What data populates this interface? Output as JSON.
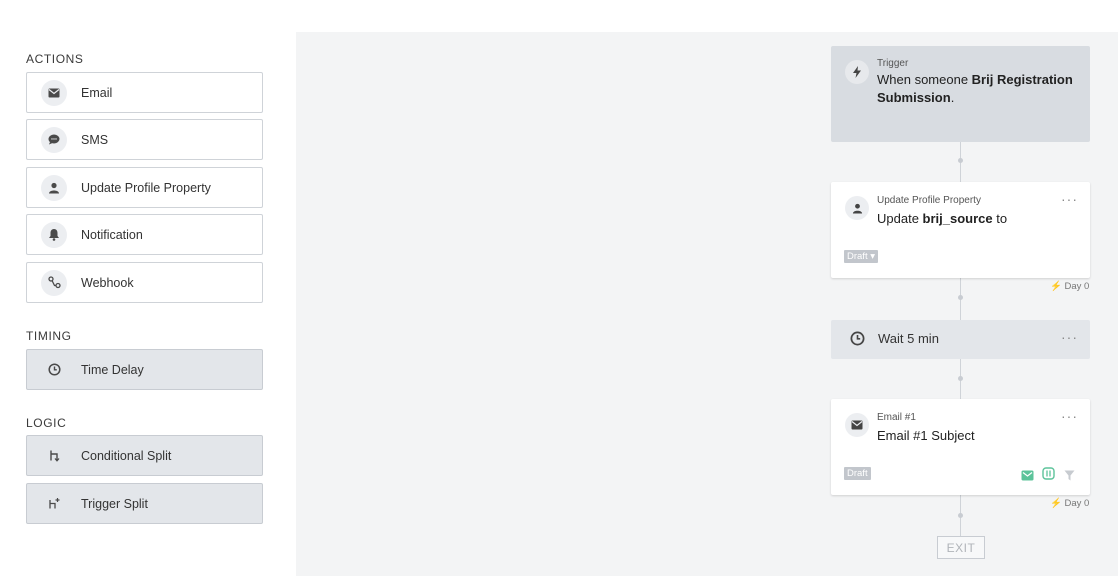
{
  "sidebar": {
    "actions_title": "ACTIONS",
    "timing_title": "TIMING",
    "logic_title": "LOGIC",
    "actions": [
      {
        "label": "Email",
        "icon": "envelope-icon"
      },
      {
        "label": "SMS",
        "icon": "chat-bubble-icon"
      },
      {
        "label": "Update Profile Property",
        "icon": "person-icon"
      },
      {
        "label": "Notification",
        "icon": "bell-icon"
      },
      {
        "label": "Webhook",
        "icon": "webhook-icon"
      }
    ],
    "timing": [
      {
        "label": "Time Delay",
        "icon": "clock-icon"
      }
    ],
    "logic": [
      {
        "label": "Conditional Split",
        "icon": "split-icon"
      },
      {
        "label": "Trigger Split",
        "icon": "trigger-split-icon"
      }
    ]
  },
  "flow": {
    "trigger": {
      "small": "Trigger",
      "text_prefix": "When someone ",
      "text_bold": "Brij Registration Submission",
      "text_suffix": "."
    },
    "update_profile": {
      "small": "Update Profile Property",
      "text_prefix": "Update ",
      "text_bold": "brij_source",
      "text_suffix": " to",
      "badge": "Draft ▾",
      "more": "···",
      "day": "⚡ Day 0"
    },
    "wait": {
      "text": "Wait 5 min",
      "more": "···"
    },
    "email": {
      "small": "Email #1",
      "subject": "Email #1 Subject",
      "badge": "Draft",
      "more": "···",
      "day": "⚡ Day 0"
    },
    "exit_label": "EXIT"
  },
  "colors": {
    "canvas_bg": "#f3f4f5",
    "trigger_card_bg": "#d8dce1",
    "green_icon": "#5cc39a",
    "draft_badge": "#c2c6cc"
  }
}
